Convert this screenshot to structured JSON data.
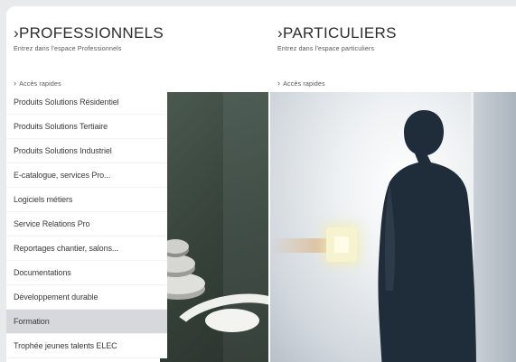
{
  "professionnels": {
    "title": "PROFESSIONNELS",
    "subtitle": "Entrez dans l'espace Professionnels",
    "quick_access": "Accès rapides",
    "menu": [
      {
        "label": "Produits Solutions Résidentiel"
      },
      {
        "label": "Produits Solutions Tertiaire"
      },
      {
        "label": "Produits Solutions Industriel"
      },
      {
        "label": "E-catalogue, services Pro..."
      },
      {
        "label": "Logiciels métiers"
      },
      {
        "label": "Service Relations Pro"
      },
      {
        "label": "Reportages chantier, salons..."
      },
      {
        "label": "Documentations"
      },
      {
        "label": "Développement durable"
      },
      {
        "label": "Formation",
        "active": true
      },
      {
        "label": "Trophée jeunes talents ELEC"
      }
    ]
  },
  "particuliers": {
    "title": "PARTICULIERS",
    "subtitle": "Entrez dans l'espace particuliers",
    "quick_access": "Accès rapides"
  },
  "icons": {
    "section_chevron": "chevron-right-icon",
    "quick_chevron": "chevron-right-icon"
  },
  "colors": {
    "title_text": "#2d2d2d",
    "menu_active_bg": "#d7d8dc",
    "page_bg": "#e9eaec"
  }
}
